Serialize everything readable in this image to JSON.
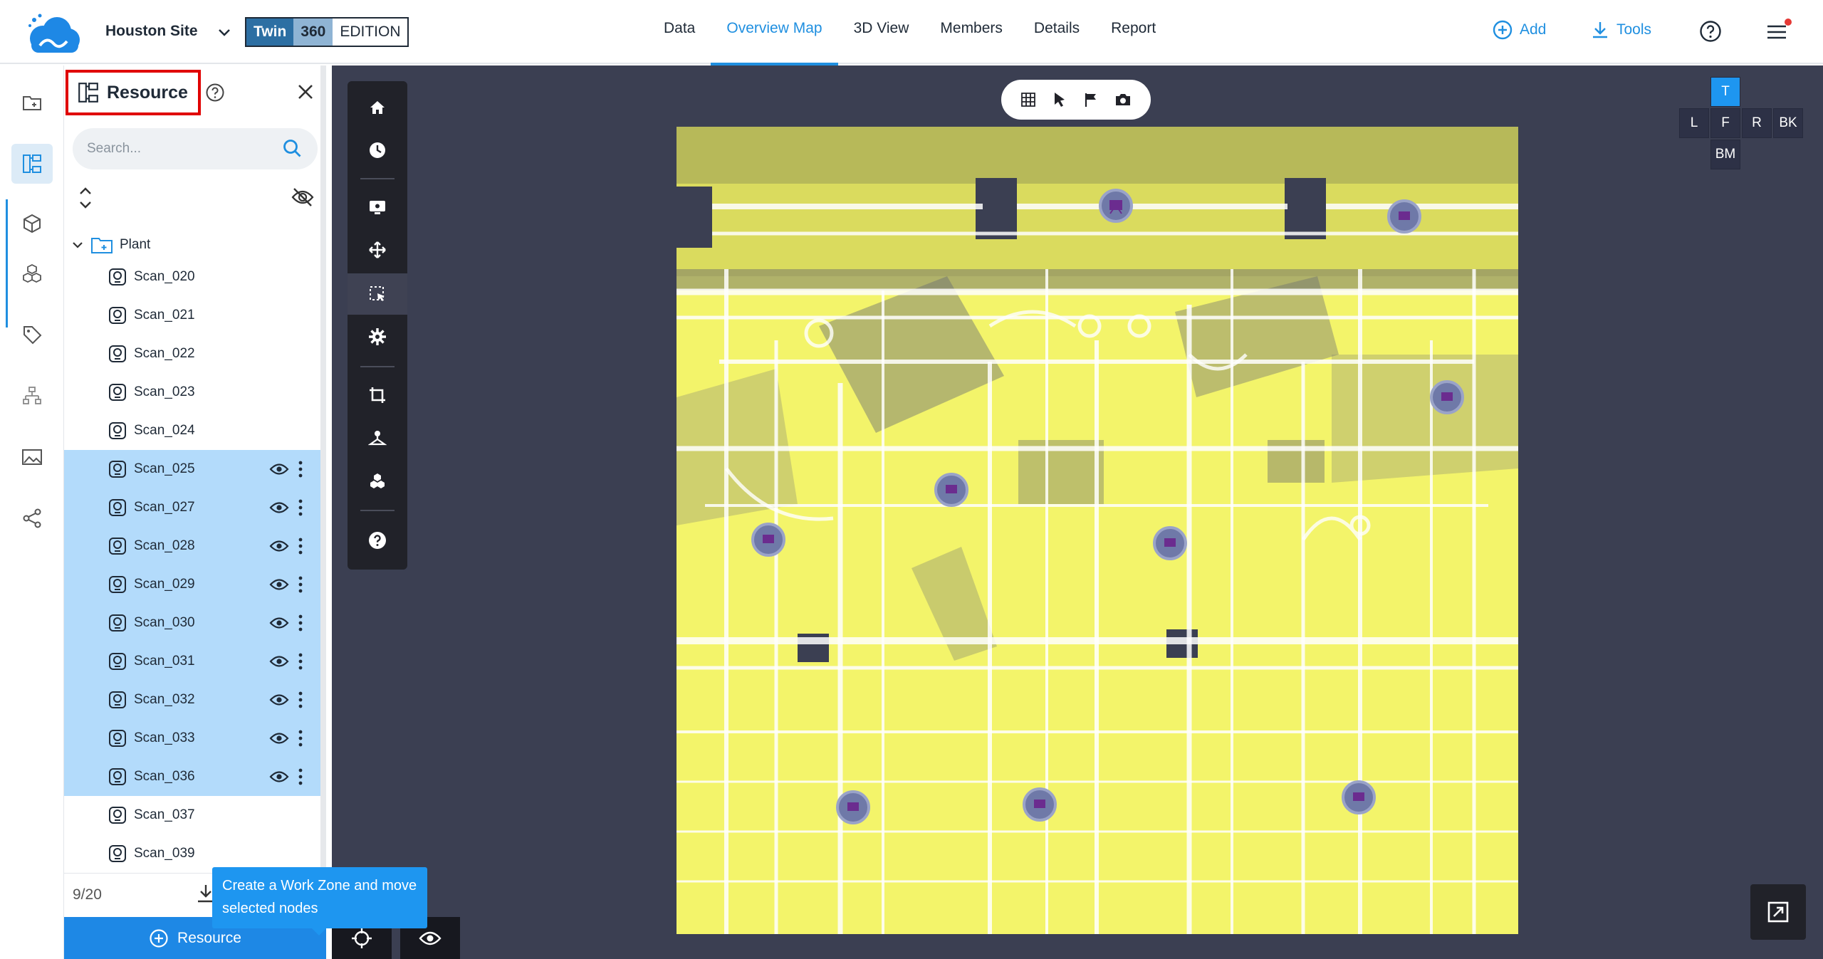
{
  "header": {
    "site_name": "Houston Site",
    "edition": {
      "twin": "Twin",
      "num": "360",
      "label": "EDITION"
    },
    "tabs": [
      {
        "label": "Data",
        "active": false
      },
      {
        "label": "Overview Map",
        "active": true
      },
      {
        "label": "3D View",
        "active": false
      },
      {
        "label": "Members",
        "active": false
      },
      {
        "label": "Details",
        "active": false
      },
      {
        "label": "Report",
        "active": false
      }
    ],
    "add_label": "Add",
    "tools_label": "Tools",
    "accent_color": "#1f8fe0"
  },
  "rail": {
    "items": [
      "folder-tree-icon",
      "hierarchy-icon",
      "cube-icon",
      "cubes-icon",
      "tag-icon",
      "network-icon",
      "image-icon",
      "share-icon"
    ],
    "active": "hierarchy-icon"
  },
  "panel": {
    "title": "Resource",
    "search_placeholder": "Search...",
    "root_label": "Plant",
    "scans": [
      {
        "label": "Scan_020",
        "selected": false
      },
      {
        "label": "Scan_021",
        "selected": false
      },
      {
        "label": "Scan_022",
        "selected": false
      },
      {
        "label": "Scan_023",
        "selected": false
      },
      {
        "label": "Scan_024",
        "selected": false
      },
      {
        "label": "Scan_025",
        "selected": true
      },
      {
        "label": "Scan_027",
        "selected": true
      },
      {
        "label": "Scan_028",
        "selected": true
      },
      {
        "label": "Scan_029",
        "selected": true
      },
      {
        "label": "Scan_030",
        "selected": true
      },
      {
        "label": "Scan_031",
        "selected": true
      },
      {
        "label": "Scan_032",
        "selected": true
      },
      {
        "label": "Scan_033",
        "selected": true
      },
      {
        "label": "Scan_036",
        "selected": true
      },
      {
        "label": "Scan_037",
        "selected": false
      },
      {
        "label": "Scan_039",
        "selected": false
      }
    ],
    "selection_count": "9/20",
    "tooltip": "Create a Work Zone and move selected nodes",
    "add_button_label": "Resource",
    "selected_color": "#b3dbfb"
  },
  "viewer": {
    "view_cube": {
      "top": "T",
      "left": "L",
      "front": "F",
      "right": "R",
      "back": "BK",
      "bottom": "BM"
    },
    "map_color": "#f4f56a",
    "background_color": "#3b3f52"
  }
}
